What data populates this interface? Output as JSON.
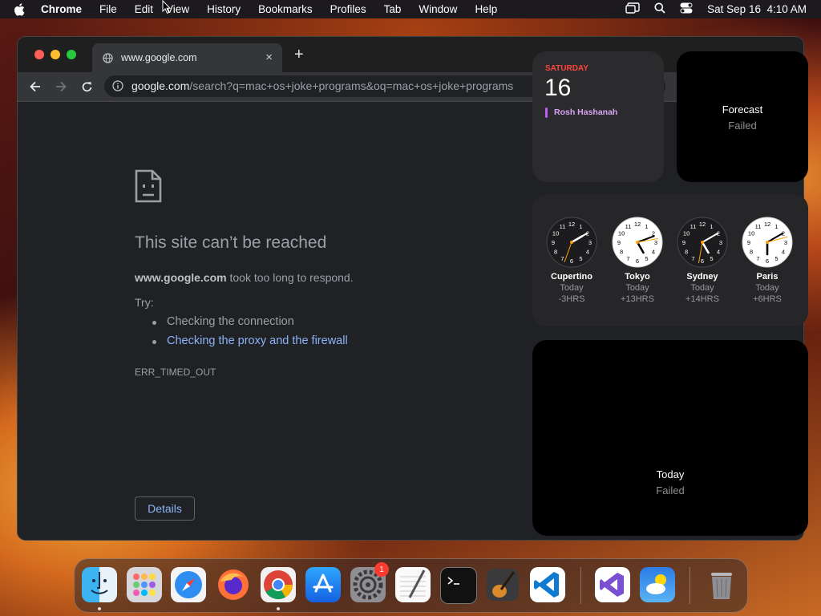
{
  "menubar": {
    "app_name": "Chrome",
    "items": [
      "File",
      "Edit",
      "View",
      "History",
      "Bookmarks",
      "Profiles",
      "Tab",
      "Window",
      "Help"
    ],
    "datetime": "Sat Sep 16  4:10 AM"
  },
  "browser": {
    "tab_title": "www.google.com",
    "tab_close": "×",
    "new_tab": "+",
    "url_domain": "google.com",
    "url_path": "/search?q=mac+os+joke+programs&oq=mac+os+joke+programs"
  },
  "error": {
    "title": "This site can’t be reached",
    "host": "www.google.com",
    "message": " took too long to respond.",
    "try_label": "Try:",
    "suggestions": [
      "Checking the connection",
      "Checking the proxy and the firewall"
    ],
    "code": "ERR_TIMED_OUT",
    "details_button": "Details",
    "link_color": "#8ab4f8"
  },
  "widgets": {
    "calendar": {
      "weekday": "SATURDAY",
      "day": "16",
      "event": "Rosh Hashanah",
      "weekday_color": "#ff453a",
      "event_color": "#bf5af2"
    },
    "forecast": {
      "title": "Forecast",
      "status": "Failed"
    },
    "clocks": [
      {
        "city": "Cupertino",
        "day": "Today",
        "offset": "-3HRS",
        "theme": "dark"
      },
      {
        "city": "Tokyo",
        "day": "Today",
        "offset": "+13HRS",
        "theme": "light"
      },
      {
        "city": "Sydney",
        "day": "Today",
        "offset": "+14HRS",
        "theme": "dark"
      },
      {
        "city": "Paris",
        "day": "Today",
        "offset": "+6HRS",
        "theme": "light"
      }
    ],
    "today": {
      "title": "Today",
      "status": "Failed"
    }
  },
  "dock": {
    "apps": [
      "finder",
      "launchpad",
      "safari",
      "firefox",
      "chrome",
      "app-store",
      "system-settings",
      "textedit",
      "terminal",
      "garageband",
      "vscode",
      "visual-studio",
      "weather",
      "trash"
    ],
    "settings_badge": "1"
  }
}
